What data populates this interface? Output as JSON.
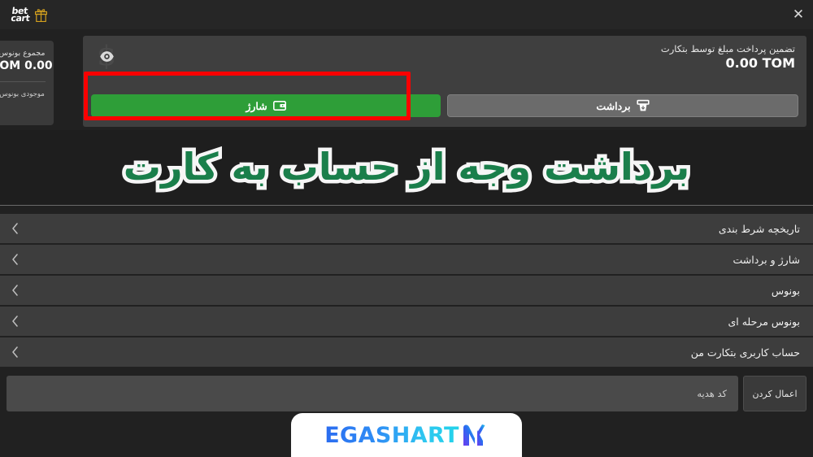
{
  "header": {
    "close_label": "✕",
    "brand_line1": "bet",
    "brand_line2": "cart",
    "gift_icon": "gift-icon"
  },
  "panel": {
    "guarantee_label": "تضمین پرداخت مبلغ توسط بتکارت",
    "guarantee_amount": "0.00 TOM",
    "eye_icon": "eye-icon",
    "charge_button": "شارژ",
    "charge_icon": "wallet-icon",
    "withdraw_button": "برداشت",
    "withdraw_icon": "cash-withdraw-icon",
    "highlight_color": "#fc0000",
    "charge_color": "#2e9e38"
  },
  "bonus_card": {
    "title": "مجموع بونوس",
    "amount": "OM 0.00",
    "subtitle": "موجودی بونوس"
  },
  "hero": {
    "headline": "برداشت وجه از حساب به کارت",
    "fill_color": "#1a7f4b",
    "stroke_color": "#f6f6f6"
  },
  "menu": {
    "items": [
      {
        "label": "تاریخچه شرط بندی",
        "icon": "chevron-left-icon"
      },
      {
        "label": "شارژ و برداشت",
        "icon": "chevron-left-icon"
      },
      {
        "label": "بونوس",
        "icon": "chevron-left-icon"
      },
      {
        "label": "بونوس مرحله ای",
        "icon": "chevron-left-icon"
      },
      {
        "label": "حساب کاربری بتکارت من",
        "icon": "chevron-left-icon"
      }
    ]
  },
  "gift": {
    "placeholder": "کد هدیه",
    "value": "",
    "apply_label": "اعمال کردن"
  },
  "watermark": {
    "text": "EGASHART",
    "mark": "M",
    "gradient_from": "#2b6cf0",
    "gradient_to": "#23d3ea"
  }
}
